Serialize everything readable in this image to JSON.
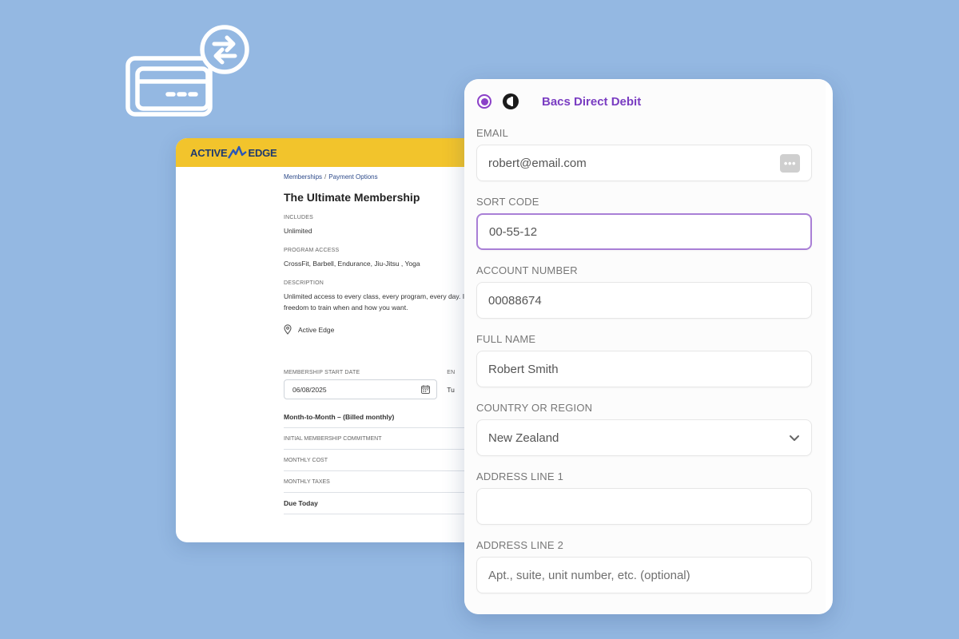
{
  "icons": {
    "card_swap": "credit-card-exchange-icon"
  },
  "membership": {
    "brand": {
      "left": "ACTIVE",
      "right": "EDGE"
    },
    "breadcrumb": {
      "root": "Memberships",
      "current": "Payment Options"
    },
    "title": "The Ultimate Membership",
    "includes": {
      "label": "INCLUDES",
      "value": "Unlimited"
    },
    "program_access": {
      "label": "PROGRAM ACCESS",
      "value": "CrossFit, Barbell, Endurance, Jiu-Jitsu , Yoga"
    },
    "description": {
      "label": "DESCRIPTION",
      "value": "Unlimited access to every class, every program, every day. I total freedom to train when and how you want."
    },
    "location": "Active Edge",
    "start_date": {
      "label": "MEMBERSHIP START DATE",
      "value": "06/08/2025"
    },
    "end_date": {
      "label": "EN",
      "value": "Tu"
    },
    "rows": [
      {
        "text": "Month-to-Month – (Billed monthly)"
      },
      {
        "text": "INITIAL MEMBERSHIP COMMITMENT"
      },
      {
        "text": "MONTHLY COST"
      },
      {
        "text": "MONTHLY TAXES"
      },
      {
        "text": "Due Today"
      }
    ]
  },
  "payment": {
    "method_title": "Bacs Direct Debit",
    "accent": "#7a3dc2",
    "fields": {
      "email": {
        "label": "EMAIL",
        "value": "robert@email.com"
      },
      "sort_code": {
        "label": "SORT CODE",
        "value": "00-55-12"
      },
      "account_number": {
        "label": "ACCOUNT NUMBER",
        "value": "00088674"
      },
      "full_name": {
        "label": "FULL NAME",
        "value": "Robert Smith"
      },
      "country": {
        "label": "COUNTRY OR REGION",
        "value": "New Zealand"
      },
      "address1": {
        "label": "ADDRESS LINE 1",
        "value": ""
      },
      "address2": {
        "label": "ADDRESS LINE 2",
        "placeholder": "Apt., suite, unit number, etc. (optional)"
      }
    },
    "email_action": "•••"
  }
}
